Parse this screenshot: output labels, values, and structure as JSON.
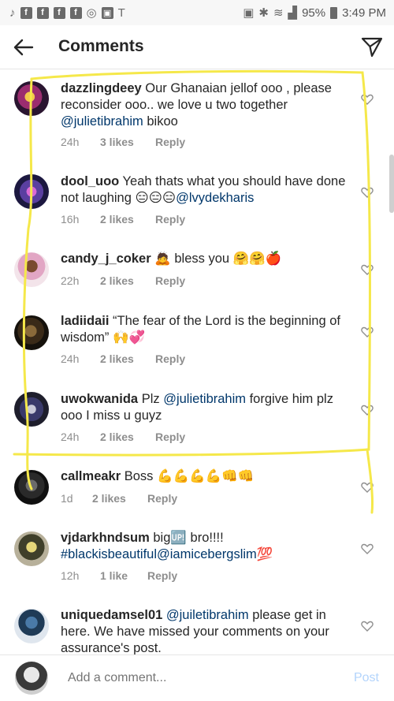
{
  "status_bar": {
    "battery": "95%",
    "time": "3:49 PM"
  },
  "header": {
    "title": "Comments"
  },
  "comments": [
    {
      "username": "dazzlingdeey",
      "text": "Our Ghanaian jellof ooo , please reconsider ooo.. we love u two together ",
      "mention": "@julietibrahim",
      "after": " bikoo",
      "time": "24h",
      "likes": "3 likes",
      "reply": "Reply"
    },
    {
      "username": "dool_uoo",
      "text": "Yeah thats what you should have done not laughing 😑😑😑",
      "mention": "@lvydekharis",
      "after": "",
      "time": "16h",
      "likes": "2 likes",
      "reply": "Reply"
    },
    {
      "username": "candy_j_coker",
      "text": "🙇 bless you 🤗🤗🍎",
      "mention": "",
      "after": "",
      "time": "22h",
      "likes": "2 likes",
      "reply": "Reply"
    },
    {
      "username": "ladiidaii",
      "text": "“The fear of the Lord is the beginning of wisdom” 🙌💞",
      "mention": "",
      "after": "",
      "time": "24h",
      "likes": "2 likes",
      "reply": "Reply"
    },
    {
      "username": "uwokwanida",
      "text": "Plz ",
      "mention": "@julietibrahim",
      "after": "  forgive him plz ooo I miss u guyz",
      "time": "24h",
      "likes": "2 likes",
      "reply": "Reply"
    },
    {
      "username": "callmeakr",
      "text": "Boss 💪💪💪💪👊👊",
      "mention": "",
      "after": "",
      "time": "1d",
      "likes": "2 likes",
      "reply": "Reply"
    },
    {
      "username": "vjdarkhndsum",
      "text": "big🆙 bro!!!! ",
      "mention": "#blackisbeautiful@iamicebergslim",
      "after": "💯",
      "time": "12h",
      "likes": "1 like",
      "reply": "Reply"
    },
    {
      "username": "uniquedamsel01",
      "text": "",
      "mention": "@juiletibrahim",
      "after": " please get in here. We have missed your comments on your assurance's  post.",
      "time": "",
      "likes": "",
      "reply": ""
    }
  ],
  "composer": {
    "placeholder": "Add a comment...",
    "post_label": "Post"
  },
  "colors": {
    "mention": "#00376b",
    "meta": "#8e8e8e",
    "post_disabled": "#b3d4fc",
    "annotation": "#f5e84a"
  }
}
